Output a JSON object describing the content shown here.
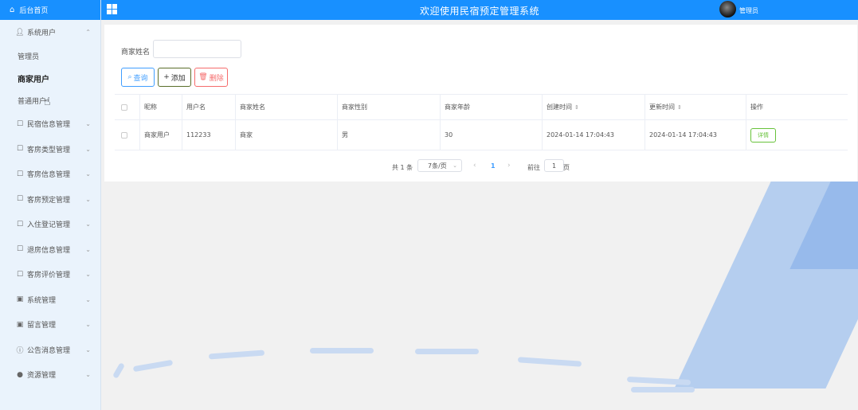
{
  "sidebar": {
    "home": "后台首页",
    "group": "系统用户",
    "sub_items": [
      "管理员",
      "商家用户",
      "普通用户"
    ],
    "items": [
      {
        "label": "民宿信息管理",
        "icon": "edit-icon"
      },
      {
        "label": "客房类型管理",
        "icon": "edit-icon"
      },
      {
        "label": "客房信息管理",
        "icon": "edit-icon"
      },
      {
        "label": "客房预定管理",
        "icon": "edit-icon"
      },
      {
        "label": "入住登记管理",
        "icon": "edit-icon"
      },
      {
        "label": "退房信息管理",
        "icon": "edit-icon"
      },
      {
        "label": "客房评价管理",
        "icon": "edit-icon"
      },
      {
        "label": "系统管理",
        "icon": "image-icon"
      },
      {
        "label": "留言管理",
        "icon": "image-icon"
      },
      {
        "label": "公告消息管理",
        "icon": "info-icon"
      },
      {
        "label": "资源管理",
        "icon": "location-icon"
      }
    ]
  },
  "header": {
    "title": "欢迎使用民宿预定管理系统",
    "user": "管理员"
  },
  "search": {
    "label": "商家姓名",
    "value": ""
  },
  "buttons": {
    "query": "查询",
    "add": "添加",
    "delete": "删除"
  },
  "table": {
    "columns": [
      "昵称",
      "用户名",
      "商家姓名",
      "商家性别",
      "商家年龄",
      "创建时间",
      "更新时间",
      "操作"
    ],
    "rows": [
      {
        "nickname": "商家用户",
        "username": "112233",
        "name": "商家",
        "gender": "男",
        "age": "30",
        "created": "2024-01-14 17:04:43",
        "updated": "2024-01-14 17:04:43",
        "action": "详情"
      }
    ]
  },
  "pagination": {
    "total": "共 1 条",
    "page_size": "7条/页",
    "current": "1",
    "goto_label": "前往",
    "goto_value": "1",
    "goto_unit": "页"
  },
  "colors": {
    "primary": "#1890ff",
    "sidebar_bg": "#eaf3fc"
  }
}
